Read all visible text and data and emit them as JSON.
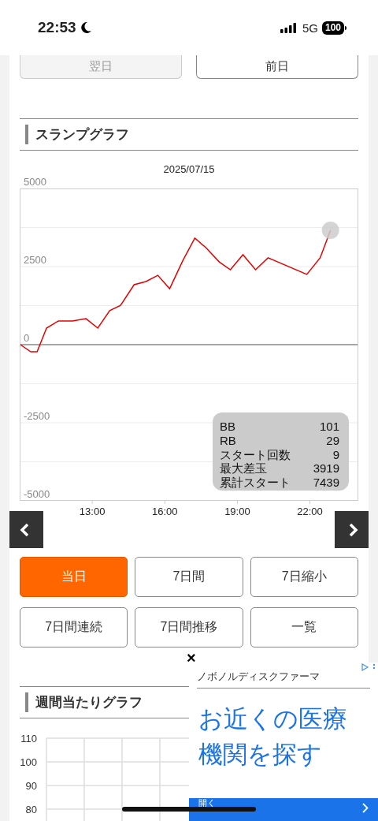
{
  "status_bar": {
    "time": "22:53",
    "network": "5G",
    "battery": "100"
  },
  "day_buttons": [
    {
      "label": "翌日",
      "disabled": true
    },
    {
      "label": "前日",
      "disabled": false
    }
  ],
  "slump_section": {
    "title": "スランプグラフ",
    "date": "2025/07/15",
    "chart_data": {
      "type": "line",
      "x": [
        10.03,
        10.46,
        10.72,
        11.11,
        11.6,
        12.18,
        12.74,
        13.23,
        13.72,
        14.17,
        14.73,
        15.22,
        15.71,
        16.2,
        16.75,
        17.24,
        17.69,
        18.25,
        18.71,
        19.23,
        19.75,
        20.27,
        21.87,
        22.42,
        22.85
      ],
      "series": [
        {
          "color": "#e60000",
          "values": [
            0,
            -230,
            -230,
            530,
            760,
            760,
            830,
            530,
            1090,
            1260,
            1920,
            2020,
            2220,
            1790,
            2700,
            3410,
            3110,
            2650,
            2400,
            2880,
            2400,
            2780,
            2250,
            2780,
            3660
          ]
        }
      ],
      "xlim": [
        10,
        24
      ],
      "ylim": [
        -5000,
        5000
      ],
      "xticks": [
        {
          "value": 13,
          "label": "13:00"
        },
        {
          "value": 16,
          "label": "16:00"
        },
        {
          "value": 19,
          "label": "19:00"
        },
        {
          "value": 22,
          "label": "22:00"
        }
      ],
      "yticks": [
        5000,
        2500,
        0,
        -2500,
        -5000
      ]
    },
    "summary": [
      {
        "label": "BB",
        "value": "101"
      },
      {
        "label": "RB",
        "value": "29"
      },
      {
        "label": "スタート回数",
        "value": "9"
      },
      {
        "label": "最大差玉",
        "value": "3919"
      },
      {
        "label": "累計スタート",
        "value": "7439"
      }
    ]
  },
  "mode_buttons": [
    {
      "label": "当日",
      "selected": true
    },
    {
      "label": "7日間",
      "selected": false
    },
    {
      "label": "7日縮小",
      "selected": false
    },
    {
      "label": "7日間連続",
      "selected": false
    },
    {
      "label": "7日間推移",
      "selected": false
    },
    {
      "label": "一覧",
      "selected": false
    }
  ],
  "weekly_section": {
    "title": "週間当たりグラフ",
    "y_labels": [
      "110",
      "100",
      "90",
      "80"
    ]
  },
  "ad": {
    "close": "×",
    "advertiser": "ノボノルディスクファーマ",
    "headline": "お近くの医療機関を探す",
    "cta": "開く"
  }
}
